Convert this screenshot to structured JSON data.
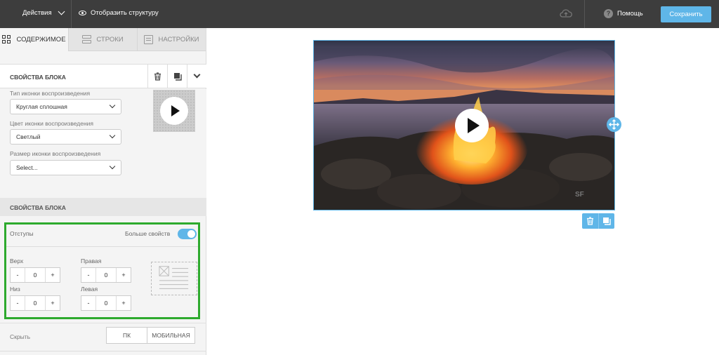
{
  "topbar": {
    "actions_label": "Действия",
    "structure_label": "Отобразить структуру",
    "help_label": "Помощь",
    "save_label": "Сохранить"
  },
  "sidebar": {
    "tabs": [
      {
        "label": "СОДЕРЖИМОЕ",
        "icon": "grid-icon",
        "active": true
      },
      {
        "label": "СТРОКИ",
        "icon": "rows-icon",
        "active": false
      },
      {
        "label": "НАСТРОЙКИ",
        "icon": "settings-icon",
        "active": false
      }
    ],
    "block_header": "СВОЙСТВА БЛОКА",
    "play_icon_type": {
      "label": "Тип иконки воспроизведения",
      "value": "Круглая сплошная"
    },
    "play_icon_color": {
      "label": "Цвет иконки воспроизведения",
      "value": "Светлый"
    },
    "play_icon_size": {
      "label": "Размер иконки воспроизведения",
      "value": "Select..."
    },
    "section2_header": "СВОЙСТВА БЛОКА",
    "padding": {
      "label": "Отступы",
      "more_label": "Больше свойств",
      "more_enabled": true,
      "top": {
        "label": "Верх",
        "value": "0"
      },
      "right": {
        "label": "Правая",
        "value": "0"
      },
      "bottom": {
        "label": "Низ",
        "value": "0"
      },
      "left": {
        "label": "Левая",
        "value": "0"
      },
      "minus": "-",
      "plus": "+"
    },
    "hide": {
      "label": "Скрыть",
      "pc": "ПК",
      "mobile": "МОБИЛЬНАЯ"
    }
  },
  "colors": {
    "accent": "#5fb6e8",
    "highlight": "#2eaa2e",
    "topbar": "#3d3d3d"
  }
}
